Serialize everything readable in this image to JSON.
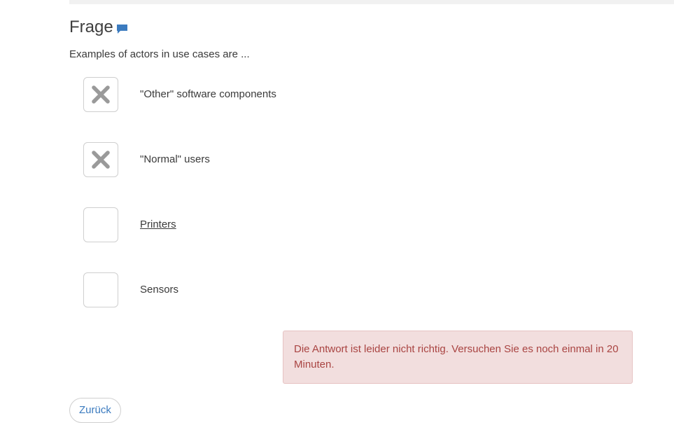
{
  "question_block": {
    "title": "Frage",
    "comment_icon": "comment-icon",
    "prompt": "Examples of actors in use cases are ..."
  },
  "options": [
    {
      "label": "\"Other\" software components",
      "checked": true,
      "mark_icon": "x-mark-icon"
    },
    {
      "label": "\"Normal\" users",
      "checked": true,
      "mark_icon": "x-mark-icon"
    },
    {
      "label": "Printers",
      "checked": false
    },
    {
      "label": "Sensors",
      "checked": false
    }
  ],
  "feedback": {
    "message": "Die Antwort ist leider nicht richtig. Versuchen Sie es noch einmal in 20 Minuten.",
    "colors": {
      "background": "#f2dede",
      "text": "#a94442"
    }
  },
  "navigation": {
    "back_label": "Zurück"
  },
  "colors": {
    "accent": "#3b7bbf",
    "mark": "#9a9a9a"
  }
}
